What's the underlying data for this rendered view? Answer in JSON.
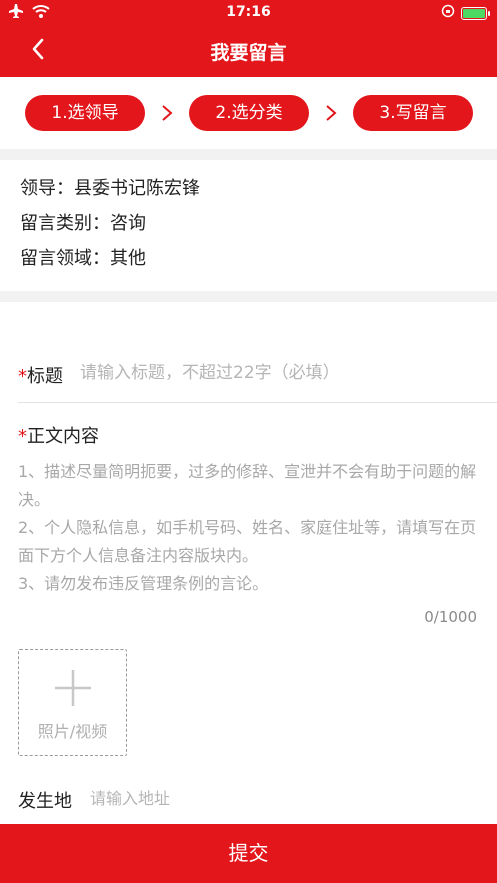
{
  "status_bar": {
    "time": "17:16",
    "icons": [
      "airplane-icon",
      "wifi-icon",
      "orientation-lock-icon",
      "battery-charging-icon"
    ],
    "battery_color": "#4cd964"
  },
  "header": {
    "title": "我要留言",
    "back_icon": "chevron-left-icon",
    "background": "#e3161b"
  },
  "steps": [
    {
      "label": "1.选领导"
    },
    {
      "label": "2.选分类"
    },
    {
      "label": "3.写留言"
    }
  ],
  "info": {
    "leader": "领导：县委书记陈宏锋",
    "category": "留言类别：咨询",
    "domain": "留言领域：其他"
  },
  "form": {
    "required_mark": "*",
    "title_label": "标题",
    "title_placeholder": "请输入标题，不超过22字（必填）",
    "body_label": "正文内容",
    "body_placeholder": "1、描述尽量简明扼要，过多的修辞、宣泄并不会有助于问题的解决。\n2、个人隐私信息，如手机号码、姓名、家庭住址等，请填写在页面下方个人信息备注内容版块内。\n3、请勿发布违反管理条例的言论。",
    "counter": "0/1000",
    "upload_label": "照片/视频",
    "address_label": "发生地",
    "address_placeholder": "请输入地址"
  },
  "submit_label": "提交"
}
